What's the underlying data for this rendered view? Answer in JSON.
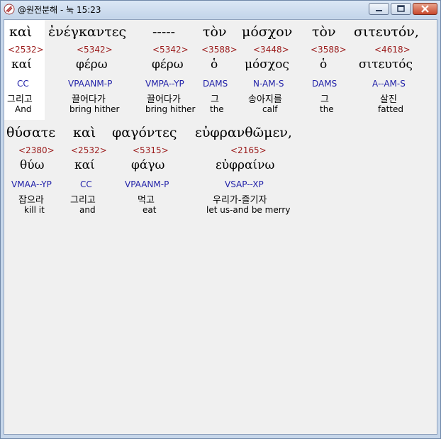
{
  "window": {
    "title": "@원전분해 - 눅 15:23"
  },
  "rows": [
    {
      "words": [
        {
          "greek": "καὶ",
          "strong": "<2532>",
          "lemma": "καί",
          "morph": "CC",
          "korean": "그리고",
          "english": "And"
        },
        {
          "greek": "ἐνέγκαντες",
          "strong": "<5342>",
          "lemma": "φέρω",
          "morph": "VPAANM-P",
          "korean": "끌어다가",
          "english": "bring hither"
        },
        {
          "greek": "-----",
          "strong": "<5342>",
          "lemma": "φέρω",
          "morph": "VMPA--YP",
          "korean": "끌어다가",
          "english": "bring hither"
        },
        {
          "greek": "τὸν",
          "strong": "<3588>",
          "lemma": "ὁ",
          "morph": "DAMS",
          "korean": "그",
          "english": "the"
        },
        {
          "greek": "μόσχον",
          "strong": "<3448>",
          "lemma": "μόσχος",
          "morph": "N-AM-S",
          "korean": "송아지를",
          "english": "calf"
        },
        {
          "greek": "τὸν",
          "strong": "<3588>",
          "lemma": "ὁ",
          "morph": "DAMS",
          "korean": "그",
          "english": "the"
        },
        {
          "greek": "σιτευτόν,",
          "strong": "<4618>",
          "lemma": "σιτευτός",
          "morph": "A--AM-S",
          "korean": "살진",
          "english": "fatted"
        }
      ]
    },
    {
      "words": [
        {
          "greek": "θύσατε",
          "strong": "<2380>",
          "lemma": "θύω",
          "morph": "VMAA--YP",
          "korean": "잡으라",
          "english": "kill it"
        },
        {
          "greek": "καὶ",
          "strong": "<2532>",
          "lemma": "καί",
          "morph": "CC",
          "korean": "그리고",
          "english": "and"
        },
        {
          "greek": "φαγόντες",
          "strong": "<5315>",
          "lemma": "φάγω",
          "morph": "VPAANM-P",
          "korean": "먹고",
          "english": "eat"
        },
        {
          "greek": "εὐφρανθῶμεν,",
          "strong": "<2165>",
          "lemma": "εὐφραίνω",
          "morph": "VSAP--XP",
          "korean": "우리가-즐기자",
          "english": "let us-and be merry"
        }
      ]
    }
  ]
}
